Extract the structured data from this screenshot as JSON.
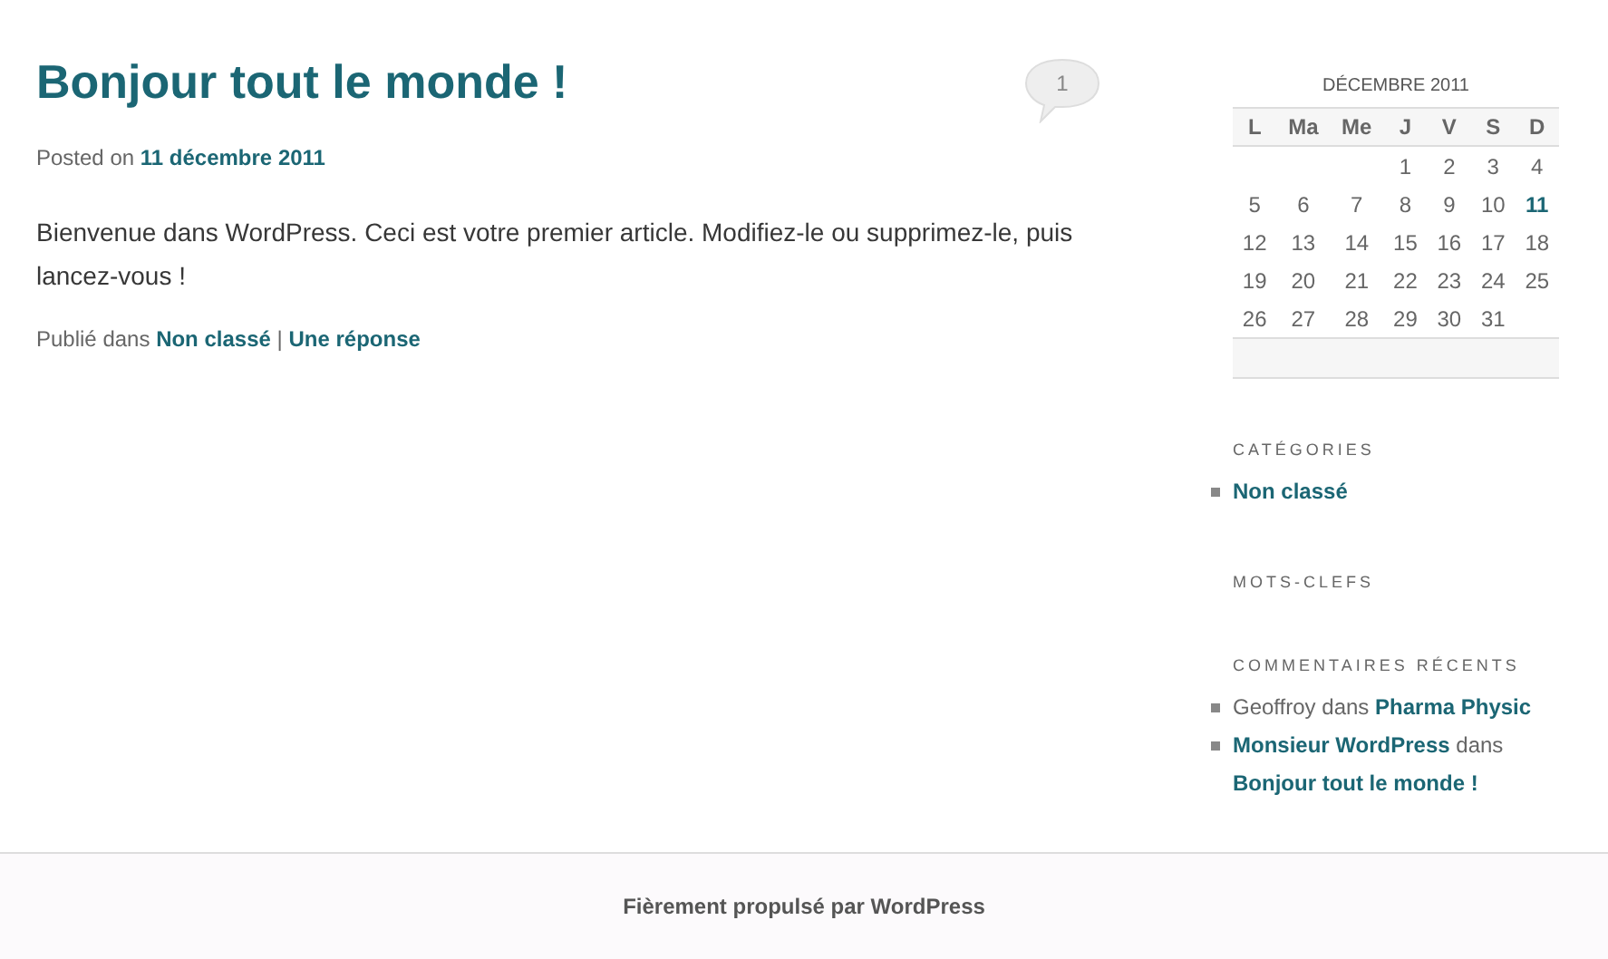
{
  "post": {
    "title": "Bonjour tout le monde !",
    "comment_count": "1",
    "posted_label": "Posted on",
    "date": "11 décembre 2011",
    "body": "Bienvenue dans WordPress. Ceci est votre premier article. Modifiez-le ou supprimez-le, puis lancez-vous !",
    "published_label": "Publié dans",
    "category": "Non classé",
    "separator": "|",
    "replies": "Une réponse"
  },
  "calendar": {
    "caption": "DÉCEMBRE 2011",
    "weekdays": [
      "L",
      "Ma",
      "Me",
      "J",
      "V",
      "S",
      "D"
    ],
    "weeks": [
      [
        {
          "kind": "blank"
        },
        {
          "kind": "blank"
        },
        {
          "kind": "blank"
        },
        {
          "kind": "day",
          "day": "1",
          "today": false
        },
        {
          "kind": "day",
          "day": "2",
          "today": false
        },
        {
          "kind": "day",
          "day": "3",
          "today": false
        },
        {
          "kind": "day",
          "day": "4",
          "today": false
        }
      ],
      [
        {
          "kind": "day",
          "day": "5",
          "today": false
        },
        {
          "kind": "day",
          "day": "6",
          "today": false
        },
        {
          "kind": "day",
          "day": "7",
          "today": false
        },
        {
          "kind": "day",
          "day": "8",
          "today": false
        },
        {
          "kind": "day",
          "day": "9",
          "today": false
        },
        {
          "kind": "day",
          "day": "10",
          "today": false
        },
        {
          "kind": "day",
          "day": "11",
          "today": true
        }
      ],
      [
        {
          "kind": "day",
          "day": "12",
          "today": false
        },
        {
          "kind": "day",
          "day": "13",
          "today": false
        },
        {
          "kind": "day",
          "day": "14",
          "today": false
        },
        {
          "kind": "day",
          "day": "15",
          "today": false
        },
        {
          "kind": "day",
          "day": "16",
          "today": false
        },
        {
          "kind": "day",
          "day": "17",
          "today": false
        },
        {
          "kind": "day",
          "day": "18",
          "today": false
        }
      ],
      [
        {
          "kind": "day",
          "day": "19",
          "today": false
        },
        {
          "kind": "day",
          "day": "20",
          "today": false
        },
        {
          "kind": "day",
          "day": "21",
          "today": false
        },
        {
          "kind": "day",
          "day": "22",
          "today": false
        },
        {
          "kind": "day",
          "day": "23",
          "today": false
        },
        {
          "kind": "day",
          "day": "24",
          "today": false
        },
        {
          "kind": "day",
          "day": "25",
          "today": false
        }
      ],
      [
        {
          "kind": "day",
          "day": "26",
          "today": false
        },
        {
          "kind": "day",
          "day": "27",
          "today": false
        },
        {
          "kind": "day",
          "day": "28",
          "today": false
        },
        {
          "kind": "day",
          "day": "29",
          "today": false
        },
        {
          "kind": "day",
          "day": "30",
          "today": false
        },
        {
          "kind": "day",
          "day": "31",
          "today": false
        },
        {
          "kind": "blank"
        }
      ]
    ]
  },
  "categories": {
    "heading": "CATÉGORIES",
    "items": [
      "Non classé"
    ]
  },
  "tags": {
    "heading": "MOTS-CLEFS"
  },
  "recent_comments": {
    "heading": "COMMENTAIRES RÉCENTS",
    "items": [
      {
        "author": "Geoffroy",
        "author_is_link": false,
        "connector": "dans",
        "post": "Pharma Physic"
      },
      {
        "author": "Monsieur WordPress",
        "author_is_link": true,
        "connector": "dans",
        "post": "Bonjour tout le monde !"
      }
    ]
  },
  "footer": "Fièrement propulsé par WordPress"
}
